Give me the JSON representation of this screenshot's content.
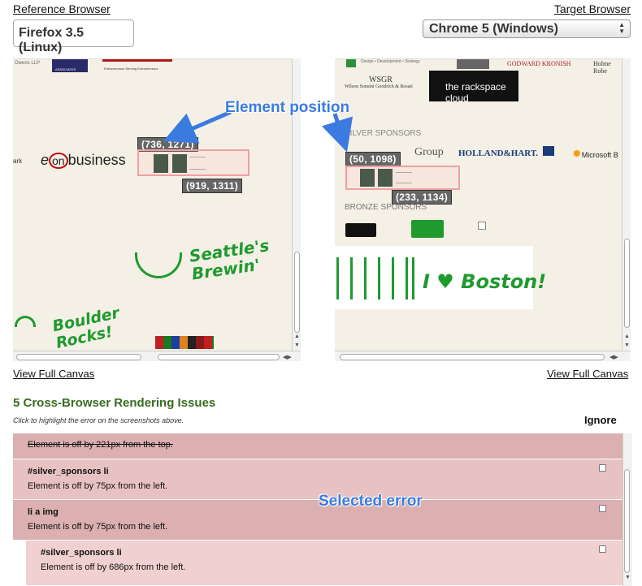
{
  "header": {
    "reference_label": "Reference Browser",
    "target_label": "Target Browser",
    "reference_browser": "Firefox 3.5 (Linux)",
    "target_browser": "Chrome 5 (Windows)"
  },
  "left_pane": {
    "top_logo_small": "Owens LLP",
    "top_logo_caption": "Entrepreneurs Serving Entrepreneurs",
    "associates": "ASSOCIATES",
    "eon_logo": "business",
    "eon_prefix": "e",
    "eon_mid": "on",
    "clip_left": "ark",
    "coord_top": "(736, 1271)",
    "coord_bottom": "(919, 1311)",
    "art1": "Seattle's Brewin'",
    "art2": "Boulder Rocks!"
  },
  "right_pane": {
    "top_tagline": "Design • Development • Strategy",
    "goddard": "GODWARD KRONISH",
    "holme": "Holme Robe",
    "wsgr": "Wilson Sonsini Goodrich & Rosati",
    "rackspace": "the rackspace cloud",
    "silver_heading": "SILVER SPONSORS",
    "group_fragment": "Group",
    "holland": "HOLLAND&HART.",
    "microsoft": "Microsoft B",
    "coord_top": "(50, 1098)",
    "coord_bottom": "(233, 1134)",
    "bronze_heading": "BRONZE SPONSORS",
    "art": "I ♥ Boston!"
  },
  "annotations": {
    "element_position": "Element position",
    "selected_error": "Selected error"
  },
  "links": {
    "view_full_canvas_left": "View Full Canvas",
    "view_full_canvas_right": "View Full Canvas"
  },
  "issues": {
    "title": "5 Cross-Browser Rendering Issues",
    "subtitle": "Click to highlight the error on the screenshots above.",
    "ignore_label": "Ignore",
    "items": [
      {
        "selector": "",
        "message": "Element is off by 221px from the top."
      },
      {
        "selector": "#silver_sponsors li",
        "message": "Element is off by 75px from the left."
      },
      {
        "selector": "li a img",
        "message": "Element is off by 75px from the left."
      },
      {
        "selector": "#silver_sponsors li",
        "message": "Element is off by 686px from the left."
      }
    ]
  },
  "colors": {
    "accent_blue": "#3b7be0",
    "issue_title_green": "#3a6b1f",
    "issue_bg": "#e8c2c2",
    "issue_bg_alt": "#dcb0b0",
    "selected_issue_bg": "#f0d0d0"
  }
}
